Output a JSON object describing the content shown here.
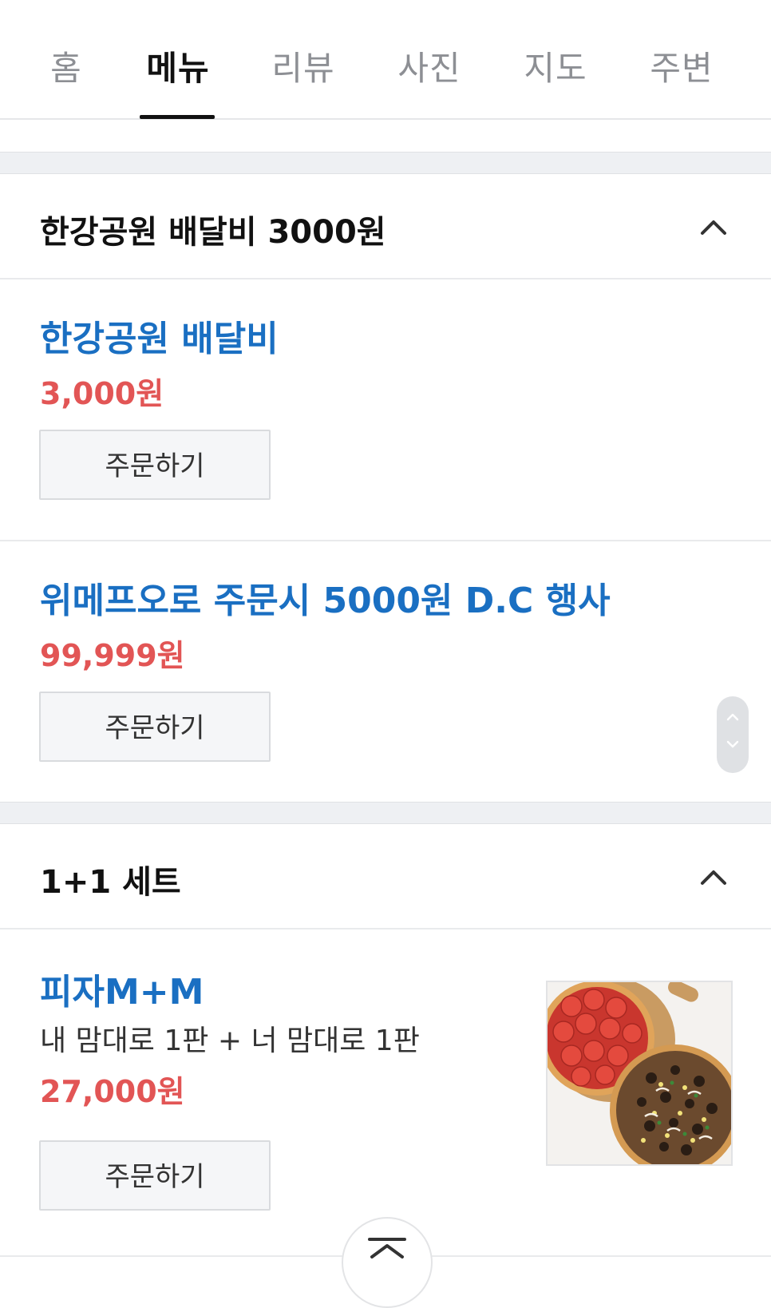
{
  "tabs": [
    {
      "label": "홈",
      "active": false
    },
    {
      "label": "메뉴",
      "active": true
    },
    {
      "label": "리뷰",
      "active": false
    },
    {
      "label": "사진",
      "active": false
    },
    {
      "label": "지도",
      "active": false
    },
    {
      "label": "주변",
      "active": false
    }
  ],
  "sections": [
    {
      "title": "한강공원 배달비 3000원",
      "items": [
        {
          "name": "한강공원 배달비",
          "price": "3,000원",
          "order_label": "주문하기"
        },
        {
          "name": "위메프오로 주문시 5000원 D.C 행사",
          "price": "99,999원",
          "order_label": "주문하기"
        }
      ]
    },
    {
      "title": "1+1 세트",
      "items": [
        {
          "name": "피자M+M",
          "description": "내 맘대로 1판 + 너 맘대로 1판",
          "price": "27,000원",
          "order_label": "주문하기"
        }
      ]
    }
  ],
  "colors": {
    "item_name": "#1a6fc2",
    "price": "#e25555",
    "section_gap": "#eef0f3"
  }
}
